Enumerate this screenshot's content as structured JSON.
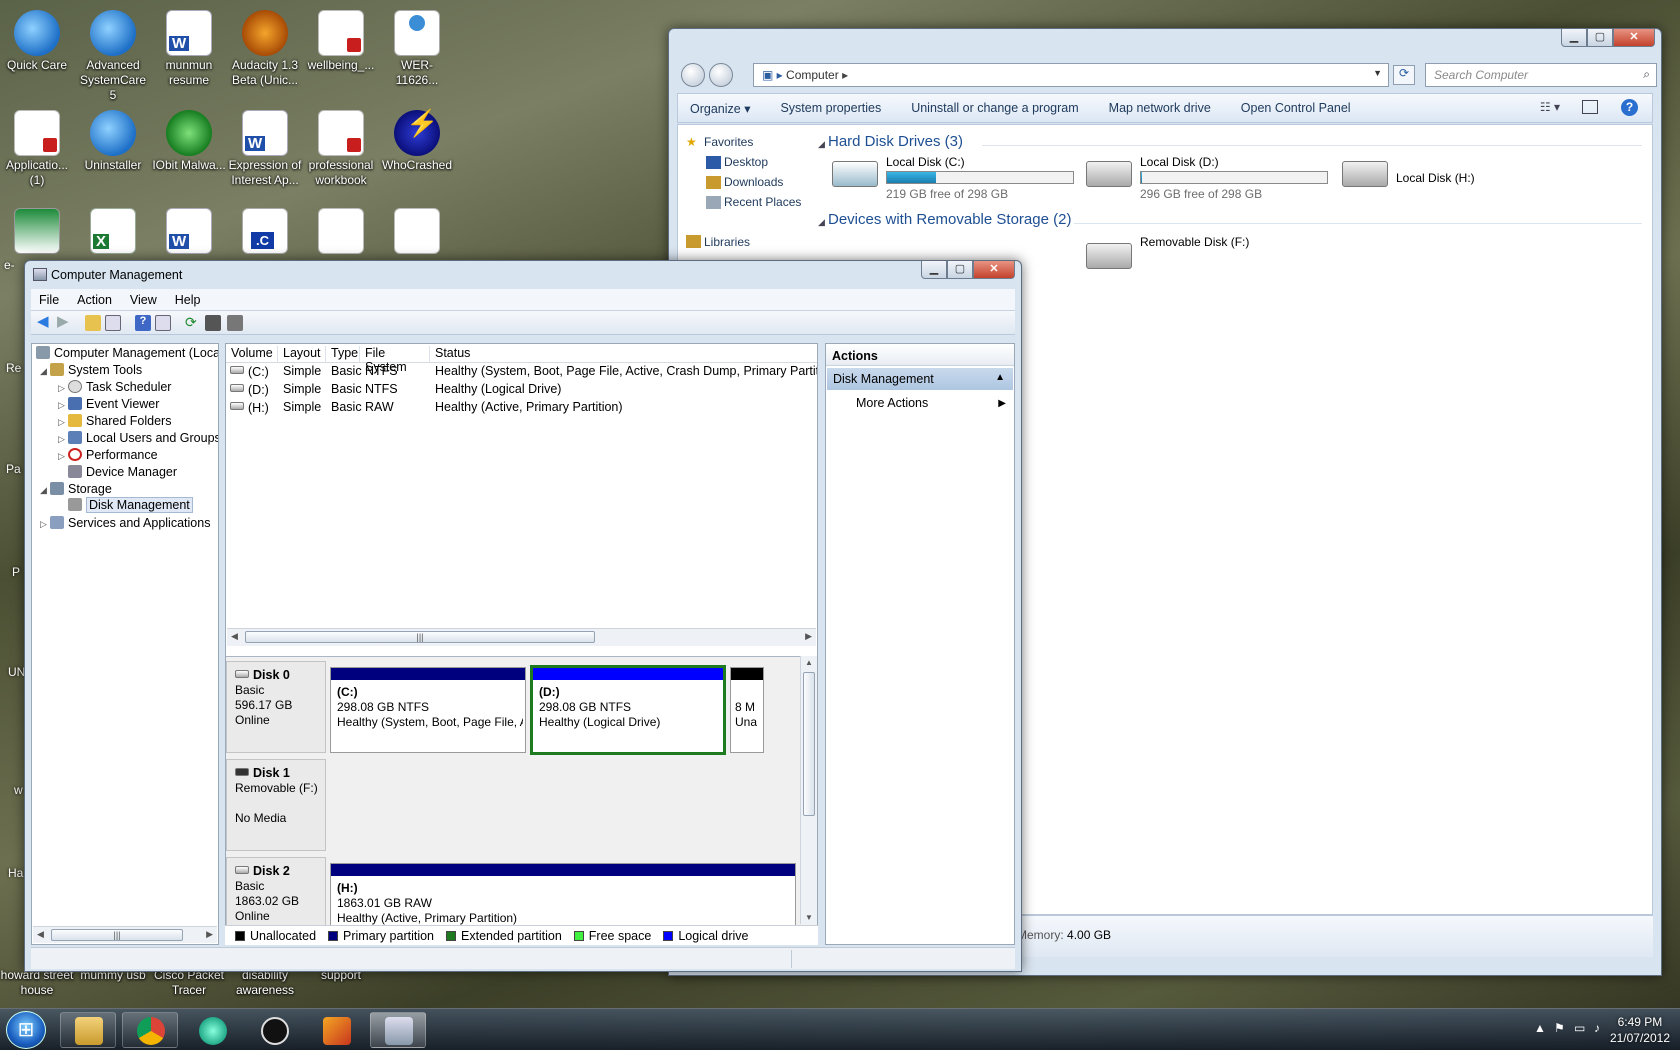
{
  "desktop": {
    "icons": [
      {
        "label": "Quick Care",
        "kind": "shield-icon"
      },
      {
        "label": "Advanced SystemCare 5",
        "kind": "shield-icon"
      },
      {
        "label": "munmun resume",
        "kind": "word-doc-icon"
      },
      {
        "label": "Audacity 1.3 Beta (Unic...",
        "kind": "audacity-icon"
      },
      {
        "label": "wellbeing_...",
        "kind": "pdf-icon"
      },
      {
        "label": "WER-11626...",
        "kind": "web-doc-icon"
      },
      {
        "label": "Applicatio... (1)",
        "kind": "pdf-icon"
      },
      {
        "label": "Uninstaller",
        "kind": "shield-icon"
      },
      {
        "label": "IObit Malwa...",
        "kind": "iobit-icon"
      },
      {
        "label": "Expression of Interest Ap...",
        "kind": "word-doc-icon"
      },
      {
        "label": "professional workbook",
        "kind": "pdf-icon"
      },
      {
        "label": "WhoCrashed",
        "kind": "whocrashed-icon"
      },
      {
        "label": "",
        "kind": "etax-icon"
      },
      {
        "label": "",
        "kind": "excel-icon"
      },
      {
        "label": "",
        "kind": "word-doc-icon"
      },
      {
        "label": "",
        "kind": "c-file-icon"
      },
      {
        "label": "",
        "kind": "text-doc-icon"
      },
      {
        "label": "",
        "kind": "text-doc-icon"
      }
    ],
    "bottom_labels": [
      "howard street house",
      "mummy usb",
      "Cisco Packet Tracer",
      "disability awareness",
      "support"
    ],
    "clipped_left_labels": [
      "e-",
      "Re",
      "Pa",
      "P",
      "UN",
      "w",
      "Ha"
    ],
    "memory_label": "Memory:",
    "memory_value": "4.00 GB",
    "ellipsis": "..."
  },
  "explorer": {
    "address": "Computer",
    "search_placeholder": "Search Computer",
    "toolbar": [
      "Organize ▾",
      "System properties",
      "Uninstall or change a program",
      "Map network drive",
      "Open Control Panel"
    ],
    "nav": {
      "favorites": "Favorites",
      "items": [
        "Desktop",
        "Downloads",
        "Recent Places"
      ],
      "libraries": "Libraries"
    },
    "hard_disk_section": "Hard Disk Drives (3)",
    "drives": [
      {
        "name": "Local Disk (C:)",
        "free": "219 GB free of 298 GB",
        "used_fraction": 0.265
      },
      {
        "name": "Local Disk (D:)",
        "free": "296 GB free of 298 GB",
        "used_fraction": 0.007
      },
      {
        "name": "Local Disk (H:)",
        "free": "",
        "used_fraction": null
      }
    ],
    "removable_section": "Devices with Removable Storage (2)",
    "removable": [
      {
        "name": "Removable Disk (F:)"
      }
    ]
  },
  "cm": {
    "title": "Computer Management",
    "menu": [
      "File",
      "Action",
      "View",
      "Help"
    ],
    "tree": {
      "root": "Computer Management (Local",
      "system_tools": "System Tools",
      "children": [
        "Task Scheduler",
        "Event Viewer",
        "Shared Folders",
        "Local Users and Groups",
        "Performance",
        "Device Manager"
      ],
      "storage": "Storage",
      "disk_management": "Disk Management",
      "services": "Services and Applications"
    },
    "columns": [
      "Volume",
      "Layout",
      "Type",
      "File System",
      "Status"
    ],
    "volumes": [
      {
        "volume": "(C:)",
        "layout": "Simple",
        "type": "Basic",
        "fs": "NTFS",
        "status": "Healthy (System, Boot, Page File, Active, Crash Dump, Primary Partition)"
      },
      {
        "volume": "(D:)",
        "layout": "Simple",
        "type": "Basic",
        "fs": "NTFS",
        "status": "Healthy (Logical Drive)"
      },
      {
        "volume": "(H:)",
        "layout": "Simple",
        "type": "Basic",
        "fs": "RAW",
        "status": "Healthy (Active, Primary Partition)"
      }
    ],
    "disks": [
      {
        "name": "Disk 0",
        "type": "Basic",
        "size": "596.17 GB",
        "state": "Online"
      },
      {
        "name": "Disk 1",
        "type": "Removable (F:)",
        "size": "",
        "state": "No Media"
      },
      {
        "name": "Disk 2",
        "type": "Basic",
        "size": "1863.02 GB",
        "state": "Online"
      }
    ],
    "partitions": {
      "c": {
        "label": "(C:)",
        "size": "298.08 GB NTFS",
        "status": "Healthy (System, Boot, Page File, A"
      },
      "d": {
        "label": "(D:)",
        "size": "298.08 GB NTFS",
        "status": "Healthy (Logical Drive)"
      },
      "unalloc": {
        "label": "8 M",
        "status": "Una"
      },
      "h": {
        "label": "(H:)",
        "size": "1863.01 GB RAW",
        "status": "Healthy (Active, Primary Partition)"
      }
    },
    "legend": [
      "Unallocated",
      "Primary partition",
      "Extended partition",
      "Free space",
      "Logical drive"
    ],
    "legend_colors": [
      "#000000",
      "#00007f",
      "#1f7a1f",
      "#3ff03f",
      "#0000ff"
    ],
    "actions": {
      "header": "Actions",
      "section": "Disk Management",
      "more": "More Actions"
    }
  },
  "taskbar": {
    "time": "6:49 PM",
    "date": "21/07/2012",
    "apps": [
      "explorer-icon",
      "chrome-icon",
      "messenger-icon",
      "steam-icon",
      "matlab-icon",
      "computer-management-icon"
    ]
  }
}
